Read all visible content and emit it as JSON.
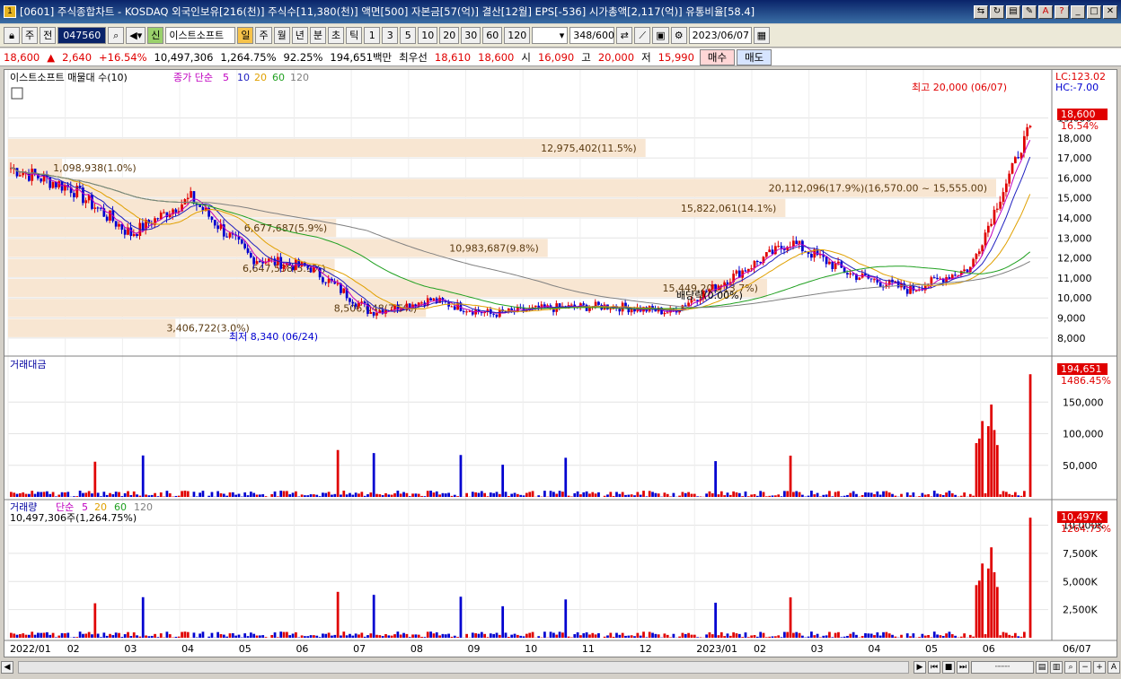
{
  "window": {
    "title": "[0601] 주식종합차트 - KOSDAQ 외국인보유[216(천)] 주식수[11,380(천)] 액면[500] 자본금[57(억)] 결산[12월] EPS[-536] 시가총액[2,117(억)] 유통비율[58.4]",
    "icon_label": "1"
  },
  "toolbar": {
    "period_label": "주",
    "prev_label": "전",
    "stock_code": "047560",
    "stock_name": "이스트소프트",
    "credit_label": "신",
    "intervals": [
      "일",
      "주",
      "월",
      "년",
      "분",
      "초",
      "틱"
    ],
    "active_interval": "일",
    "minutes": [
      "1",
      "3",
      "5",
      "10",
      "20",
      "30",
      "60",
      "120"
    ],
    "count_value": "348",
    "count_total": "/600",
    "date_value": "2023/06/07"
  },
  "quote": {
    "price": "18,600",
    "arrow": "▲",
    "change": "2,640",
    "change_pct": "+16.54%",
    "volume": "10,497,306",
    "volume_pct": "1,264.75%",
    "ratio": "92.25%",
    "amount": "194,651백만",
    "best_label": "최우선",
    "best_ask": "18,610",
    "best_bid": "18,600",
    "open_label": "시",
    "open": "16,090",
    "high_label": "고",
    "high": "20,000",
    "low_label": "저",
    "low": "15,990",
    "buy_label": "매수",
    "sell_label": "매도"
  },
  "panels": {
    "price": {
      "legend_name": "이스트소프트 매물대 수(10)",
      "ma_legend_label": "종가 단순",
      "ma_periods": [
        "5",
        "10",
        "20",
        "60",
        "120"
      ],
      "ma_colors": [
        "#c000c0",
        "#2020c0",
        "#e0a000",
        "#20a020",
        "#808080"
      ],
      "lc_label": "LC:123.02",
      "hc_label": "HC:-7.00",
      "last_price_badge": "18,600",
      "last_pct_badge": "16.54%",
      "y_ticks": [
        "19,000",
        "18,000",
        "17,000",
        "16,000",
        "15,000",
        "14,000",
        "13,000",
        "12,000",
        "11,000",
        "10,000",
        "9,000",
        "8,000"
      ],
      "high_annot": "최고 20,000 (06/07)",
      "low_annot": "최저 8,340 (06/24)",
      "dividend_annot": "배당락(0.00%)",
      "volume_profile": [
        {
          "label": "3,406,722(3.0%)",
          "low": 8000,
          "high": 9000
        },
        {
          "label": "8,506,048(7.5%)",
          "low": 9000,
          "high": 10000
        },
        {
          "label": "15,449,201(13.7%)",
          "low": 10000,
          "high": 11000
        },
        {
          "label": "6,647,538(5.9%)",
          "low": 11000,
          "high": 12000
        },
        {
          "label": "10,983,687(9.8%)",
          "low": 12000,
          "high": 13000
        },
        {
          "label": "6,677,687(5.9%)",
          "low": 13000,
          "high": 14000
        },
        {
          "label": "15,822,061(14.1%)",
          "low": 14000,
          "high": 15000
        },
        {
          "label": "20,112,096(17.9%)(16,570.00 ~ 15,555.00)",
          "low": 15000,
          "high": 16000
        },
        {
          "label": "1,098,938(1.0%)",
          "low": 16000,
          "high": 17000
        },
        {
          "label": "12,975,402(11.5%)",
          "low": 17000,
          "high": 18000
        }
      ]
    },
    "amount": {
      "legend_name": "거래대금",
      "last_badge": "194,651",
      "last_pct_badge": "1486.45%",
      "y_ticks": [
        "150,000",
        "100,000",
        "50,000"
      ]
    },
    "volume": {
      "legend_name": "거래량",
      "ma_legend_label": "단순",
      "ma_periods": [
        "5",
        "20",
        "60",
        "120"
      ],
      "current": "10,497,306주(1,264.75%)",
      "last_badge": "10,497K",
      "last_pct_badge": "1264.75%",
      "y_ticks": [
        "10,000K",
        "7,500K",
        "5,000K",
        "2,500K"
      ]
    },
    "x_axis": [
      "2022/01",
      "02",
      "03",
      "04",
      "05",
      "06",
      "07",
      "08",
      "09",
      "10",
      "11",
      "12",
      "2023/01",
      "02",
      "03",
      "04",
      "05",
      "06",
      "06/07"
    ]
  },
  "chart_data": {
    "type": "candlestick",
    "x_range": [
      "2022/01",
      "2023/06/07"
    ],
    "ylim": [
      7500,
      20500
    ],
    "approx_close_by_month": [
      {
        "x": "2022/01",
        "close": 16500
      },
      {
        "x": "2022/02",
        "close": 15500
      },
      {
        "x": "2022/03",
        "close": 13200
      },
      {
        "x": "2022/04",
        "close": 15000
      },
      {
        "x": "2022/05",
        "close": 12000
      },
      {
        "x": "2022/06",
        "close": 11500
      },
      {
        "x": "2022/07",
        "close": 9300
      },
      {
        "x": "2022/08",
        "close": 9900
      },
      {
        "x": "2022/09",
        "close": 9200
      },
      {
        "x": "2022/10",
        "close": 9500
      },
      {
        "x": "2022/11",
        "close": 9600
      },
      {
        "x": "2022/12",
        "close": 9300
      },
      {
        "x": "2023/01",
        "close": 11000
      },
      {
        "x": "2023/02",
        "close": 12800
      },
      {
        "x": "2023/03",
        "close": 11200
      },
      {
        "x": "2023/04",
        "close": 10400
      },
      {
        "x": "2023/05",
        "close": 11500
      },
      {
        "x": "2023/06",
        "close": 18600
      }
    ],
    "high": 20000,
    "low": 8340
  }
}
